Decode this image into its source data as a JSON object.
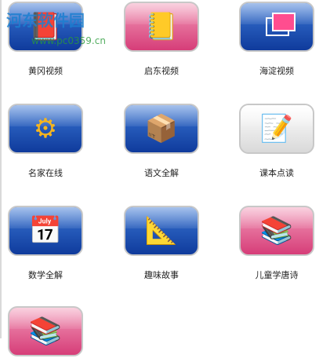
{
  "watermark": {
    "text": "河东软件园",
    "url": "www.pc0359.cn"
  },
  "apps": [
    {
      "label": "黄冈视频",
      "icon": "red-book-icon",
      "color": "blue"
    },
    {
      "label": "启东视频",
      "icon": "pencil-book-icon",
      "color": "pink"
    },
    {
      "label": "海淀视频",
      "icon": "layers-icon",
      "color": "blue"
    },
    {
      "label": "名家在线",
      "icon": "gear-icon",
      "color": "blue"
    },
    {
      "label": "语文全解",
      "icon": "books-icon",
      "color": "blue"
    },
    {
      "label": "课本点读",
      "icon": "document-pen-icon",
      "color": "white"
    },
    {
      "label": "数学全解",
      "icon": "calendar-icon",
      "color": "blue"
    },
    {
      "label": "趣味故事",
      "icon": "drawing-tools-icon",
      "color": "blue"
    },
    {
      "label": "儿童学唐诗",
      "icon": "book-stack-icon",
      "color": "pink"
    }
  ],
  "partial": {
    "icon": "book-stack-icon"
  }
}
